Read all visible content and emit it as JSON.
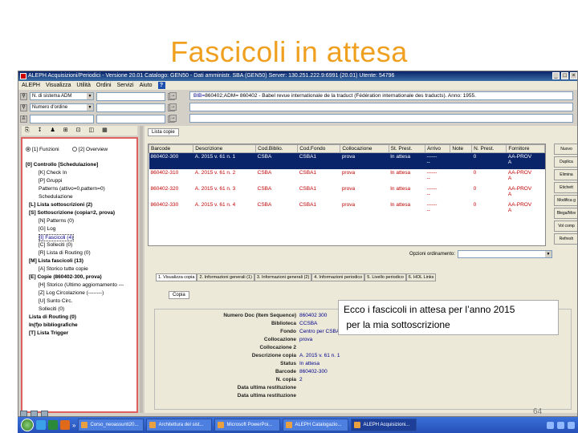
{
  "slide": {
    "title": "Fascicoli in attesa",
    "annotation_line1": "Ecco i fascicoli in attesa per l’anno 2015",
    "annotation_line2": " per la mia sottoscrizione",
    "page_number": "64"
  },
  "window": {
    "title": "ALEPH Acquisizioni/Periodici - Versione 20.01 Catalogo: GEN50 - Dati amministr. SBA (GEN50) Server: 130.251.222.9:6991 (20.01) Utente: 54796",
    "controls": [
      "_",
      "□",
      "×"
    ]
  },
  "menu": {
    "items": [
      "ALEPH",
      "Visualizza",
      "Utilità",
      "Ordini",
      "Servizi",
      "Aiuto"
    ],
    "help_icon": "?"
  },
  "search": {
    "combo1": "N. di sistema ADM",
    "combo2": "Numero d'ordine",
    "bib_label": "BIB=",
    "bib_text": "860402;ADM= 860402 - Babel revue internationale de la traduct (Fédération internationale des traducts). Anno: 1955."
  },
  "left_toolbar_icons": [
    "⎘",
    "↧",
    "♟",
    "⊞",
    "⊡",
    "◫",
    "▦"
  ],
  "tree": {
    "radio1": "[1] Funzioni",
    "radio2": "[2] Overview",
    "lines": [
      "[0] Controllo [Schedulazione]",
      "[K] Check In",
      "[P] Gruppi",
      "Patterns (attivo=0,pattern=0)",
      "Schedulazione",
      "[L] Lista sottoscrizioni (2)",
      "[S] Sottoscrizione (copia=2, prova)",
      "[N] Patterns (0)",
      "[G] Log",
      "[I] Fascicoli (4)",
      "[C] Solleciti (0)",
      "[R] Lista di Routing (0)",
      "[M] Lista fascicoli (13)",
      "[A] Storico tutte copie",
      "[E] Copie (860402-300, prova)",
      "[H] Storico (Ultimo aggiornamento ---",
      "[Z] Log Circolazione (--------)",
      "[U] Sunto Circ.",
      "Solleciti (0)",
      "Lista di Routing (0)",
      "In(f)o bibliografiche",
      "[T] Lista Trigger"
    ]
  },
  "list_tab": "Lista copie",
  "grid": {
    "headers": [
      "Barcode",
      "Descrizione",
      "Cod.Biblio.",
      "Cod.Fondo",
      "Collocazione",
      "St. Prest.",
      "Arrivo",
      "Note",
      "N. Prest.",
      "Fornitore"
    ],
    "rows": [
      [
        "860402-300",
        "A. 2015 v. 61 n. 1",
        "CSBA",
        "CSBA1",
        "prova",
        "In attesa",
        "------",
        "--",
        "0",
        "AA-PROV",
        "A"
      ],
      [
        "860402-310",
        "A. 2015 v. 61 n. 2",
        "CSBA",
        "CSBA1",
        "prova",
        "In attesa",
        "------",
        "--",
        "0",
        "AA-PROV",
        "A"
      ],
      [
        "860402-320",
        "A. 2015 v. 61 n. 3",
        "CSBA",
        "CSBA1",
        "prova",
        "In attesa",
        "------",
        "--",
        "0",
        "AA-PROV",
        "A"
      ],
      [
        "860402-330",
        "A. 2015 v. 61 n. 4",
        "CSBA",
        "CSBA1",
        "prova",
        "In attesa",
        "------",
        "--",
        "0",
        "AA-PROV",
        "A"
      ]
    ]
  },
  "side_buttons": [
    "Nuovo",
    "Duplica",
    "Elimina",
    "Etichett",
    "Modifica g",
    "Blega/Mov",
    "Vol comp",
    "Refresh"
  ],
  "options_label": "Opzioni ordinamento:",
  "lower_tabs": [
    "1. Visualizza copia",
    "2. Informazioni generali (1)",
    "3. Informazioni generali (2)",
    "4. Informazioni periodico",
    "5. Livello periodico",
    "6. HOL Links"
  ],
  "copia_tab": "Copia",
  "detail": [
    {
      "label": "Numero Doc (Item Sequence)",
      "value": "860402 300"
    },
    {
      "label": "Biblioteca",
      "value": "CCSBA"
    },
    {
      "label": "Fondo",
      "value": "Centro per CSBA"
    },
    {
      "label": "Collocazione",
      "value": "prova"
    },
    {
      "label": "Collocazione 2",
      "value": ""
    },
    {
      "label": "Descrizione copia",
      "value": "A. 2015 v. 61 n. 1"
    },
    {
      "label": "Status",
      "value": "In attesa"
    },
    {
      "label": "Barcode",
      "value": "860402-300"
    },
    {
      "label": "N. copia",
      "value": "2"
    },
    {
      "label": "Data ultima restituzione",
      "value": ""
    },
    {
      "label": "Data ultima restituzione",
      "value": ""
    }
  ],
  "taskbar": {
    "items": [
      "Corso_neoassunti20...",
      "Architettura del sist...",
      "Microsoft PowerPoi...",
      "ALEPH Catalogazio...",
      "ALEPH Acquisizioni..."
    ],
    "chevron": "»"
  },
  "colors": {
    "title": "#f0a020",
    "selected_row": "#0a246a",
    "row_text": "#c00000",
    "tree_border": "#e06060"
  }
}
